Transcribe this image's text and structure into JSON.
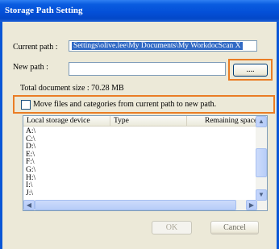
{
  "window": {
    "title": "Storage Path Setting"
  },
  "current_path": {
    "label": "Current path :",
    "value": "Settings\\olive.lee\\My Documents\\My WorkdocScan X"
  },
  "new_path": {
    "label": "New path :",
    "value": "",
    "browse_label": "...."
  },
  "total_size": "Total document size : 70.28 MB",
  "move_option": {
    "label": "Move files and categories from current path to new path.",
    "checked": false
  },
  "storage_list": {
    "columns": [
      "Local storage device",
      "Type",
      "Remaining space"
    ],
    "rows": [
      "A:\\",
      "C:\\",
      "D:\\",
      "E:\\",
      "F:\\",
      "G:\\",
      "H:\\",
      "I:\\",
      "J:\\"
    ]
  },
  "buttons": {
    "ok": "OK",
    "cancel": "Cancel"
  },
  "highlight_color": "#ea7d25"
}
